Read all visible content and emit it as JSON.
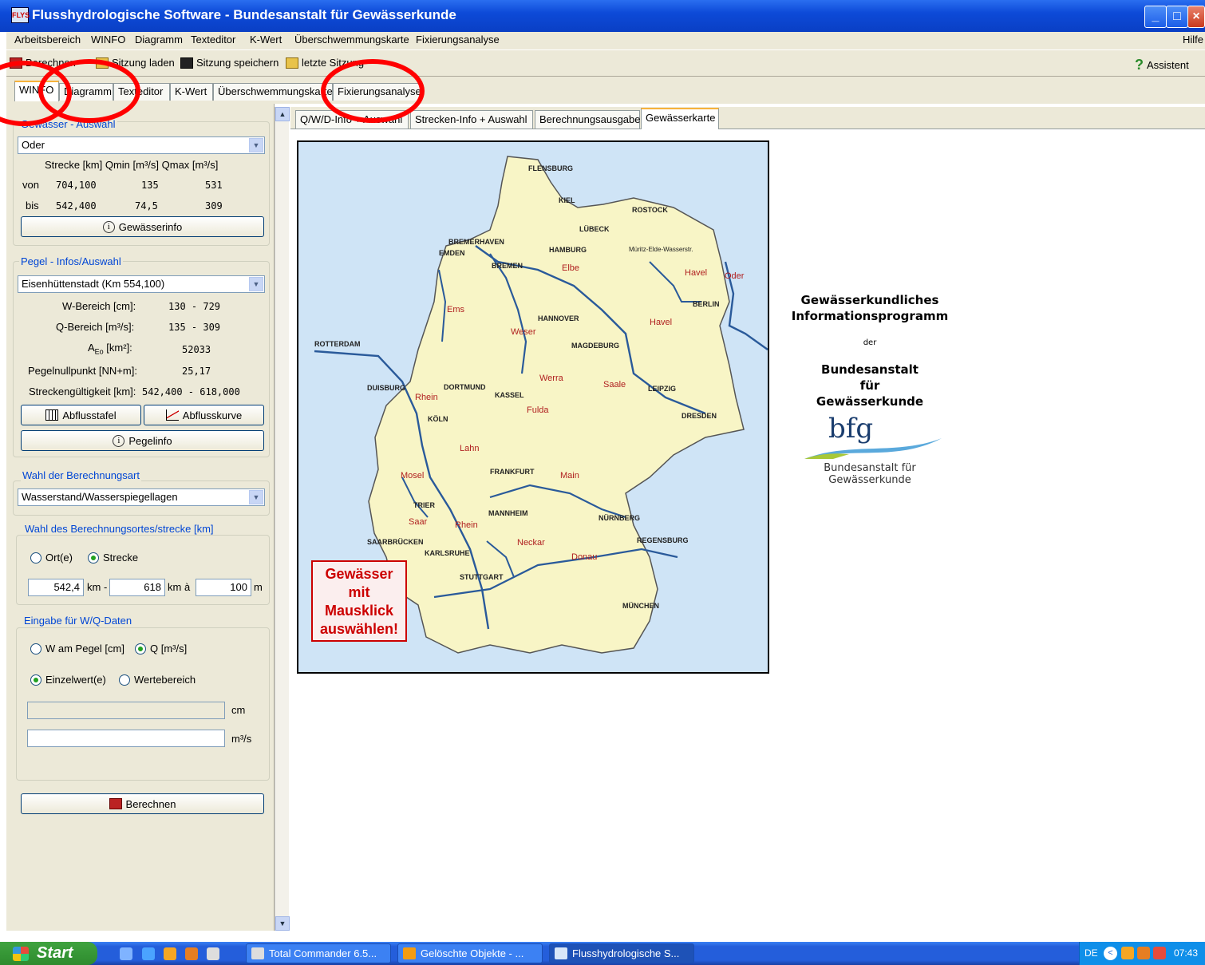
{
  "window": {
    "title": "Flusshydrologische Software - Bundesanstalt für Gewässerkunde",
    "icon_text": "FLYS"
  },
  "menubar": {
    "items": [
      "Arbeitsbereich",
      "WINFO",
      "Diagramm",
      "Texteditor",
      "K-Wert",
      "Überschwemmungskarte",
      "Fixierungsanalyse"
    ],
    "help": "Hilfe"
  },
  "toolbar": {
    "calc": "Berechnen",
    "load": "Sitzung laden",
    "save": "Sitzung speichern",
    "last": "letzte Sitzung",
    "assistant": "Assistent"
  },
  "main_tabs": [
    "WINFO",
    "Diagramm",
    "Texteditor",
    "K-Wert",
    "Überschwemmungskarte",
    "Fixierungsanalyse"
  ],
  "left": {
    "gewaesser": {
      "title": "Gewässer - Auswahl",
      "selected": "Oder",
      "head": "Strecke [km]  Qmin [m³/s]  Qmax [m³/s]",
      "von_label": "von",
      "von_km": "704,100",
      "von_qmin": "135",
      "von_qmax": "531",
      "bis_label": "bis",
      "bis_km": "542,400",
      "bis_qmin": "74,5",
      "bis_qmax": "309",
      "info_btn": "Gewässerinfo"
    },
    "pegel": {
      "title": "Pegel - Infos/Auswahl",
      "selected": "Eisenhüttenstadt   (Km 554,100)",
      "w_label": "W-Bereich [cm]:",
      "w_value": "130 - 729",
      "q_label": "Q-Bereich [m³/s]:",
      "q_value": "135 - 309",
      "a_label_main": "A",
      "a_label_sub": "Eo",
      "a_label_unit": " [km²]:",
      "a_value": "52033",
      "pnp_label": "Pegelnullpunkt [NN+m]:",
      "pnp_value": "25,17",
      "sg_label": "Streckengültigkeit [km]:",
      "sg_value": "542,400 - 618,000",
      "btn_tafel": "Abflusstafel",
      "btn_kurve": "Abflusskurve",
      "btn_info": "Pegelinfo"
    },
    "berechnungsart": {
      "title": "Wahl der Berechnungsart",
      "selected": "Wasserstand/Wasserspiegellagen"
    },
    "ort": {
      "title": "Wahl des Berechnungsortes/strecke [km]",
      "opt_ort": "Ort(e)",
      "opt_strecke": "Strecke",
      "from": "542,4",
      "km_dash": "km -",
      "to": "618",
      "km_a": "km  à",
      "step": "100",
      "m": "m"
    },
    "wq": {
      "title": "Eingabe für W/Q-Daten",
      "opt_w": "W am Pegel [cm]",
      "opt_q": "Q [m³/s]",
      "opt_einzel": "Einzelwert(e)",
      "opt_bereich": "Wertebereich",
      "unit_cm": "cm",
      "unit_m3s": "m³/s"
    },
    "calc_btn": "Berechnen"
  },
  "sub_tabs": [
    "Q/W/D-Info + Auswahl",
    "Strecken-Info + Auswahl",
    "Berechnungsausgabe",
    "Gewässerkarte"
  ],
  "map": {
    "cities": [
      "FLENSBURG",
      "KIEL",
      "ROSTOCK",
      "LÜBECK",
      "BREMERHAVEN",
      "EMDEN",
      "HAMBURG",
      "Müritz-Elde-Wasserstr.",
      "BREMEN",
      "BERLIN",
      "HANNOVER",
      "MAGDEBURG",
      "ROTTERDAM",
      "DORTMUND",
      "DUISBURG",
      "KASSEL",
      "LEIPZIG",
      "KÖLN",
      "DRESDEN",
      "FRANKFURT",
      "TRIER",
      "MANNHEIM",
      "NÜRNBERG",
      "SAARBRÜCKEN",
      "KARLSRUHE",
      "REGENSBURG",
      "STUTTGART",
      "MÜNCHEN"
    ],
    "rivers": [
      "Elbe",
      "Havel",
      "Oder",
      "Havel",
      "Ems",
      "Weser",
      "Werra",
      "Saale",
      "Rhein",
      "Fulda",
      "Lahn",
      "Mosel",
      "Main",
      "Saar",
      "Rhein",
      "Neckar",
      "Donau"
    ],
    "note_lines": [
      "Gewässer",
      "mit",
      "Mausklick",
      "auswählen!"
    ]
  },
  "info": {
    "line1": "Gewässerkundliches",
    "line2": "Informationsprogramm",
    "der": "der",
    "line3": "Bundesanstalt",
    "line4": "für",
    "line5": "Gewässerkunde",
    "logo": "bfg",
    "logo_sub1": "Bundesanstalt für",
    "logo_sub2": "Gewässerkunde"
  },
  "taskbar": {
    "start": "Start",
    "tasks": [
      "Total Commander 6.5...",
      "Gelöschte Objekte - ...",
      "Flusshydrologische S..."
    ],
    "lang": "DE",
    "time": "07:43"
  },
  "colors": {
    "title_blue": "#0d4ad8",
    "accent_tab": "#f7b23b",
    "annotation_red": "#ff0000",
    "group_title": "#0046d5"
  }
}
